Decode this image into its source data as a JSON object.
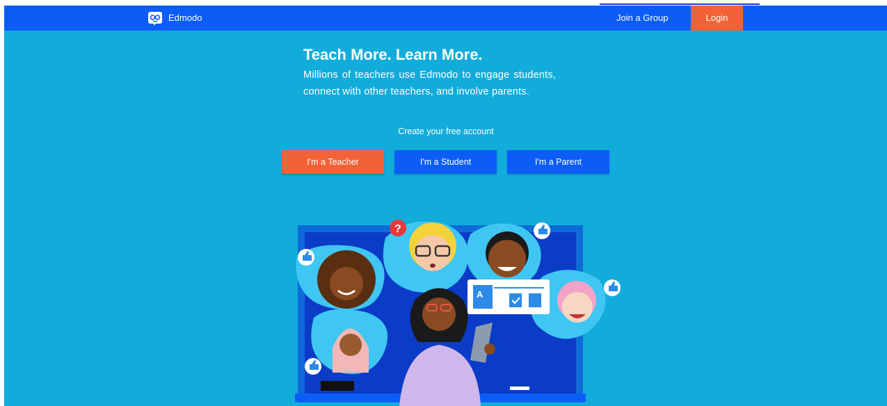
{
  "navbar": {
    "brand": "Edmodo",
    "join_group": "Join a Group",
    "login": "Login"
  },
  "hero": {
    "title": "Teach More. Learn More.",
    "subtitle": "Millions of teachers use Edmodo to engage students, connect with other teachers, and involve parents.",
    "create_label": "Create your free account"
  },
  "roles": {
    "teacher": "I'm a Teacher",
    "student": "I'm a Student",
    "parent": "I'm a Parent"
  },
  "illustration": {
    "question_mark": "?",
    "app_letter": "A"
  },
  "colors": {
    "page_bg": "#12ACDB",
    "navbar_bg": "#0C5DF7",
    "accent_orange": "#F26236",
    "button_blue": "#0C5DF7"
  }
}
